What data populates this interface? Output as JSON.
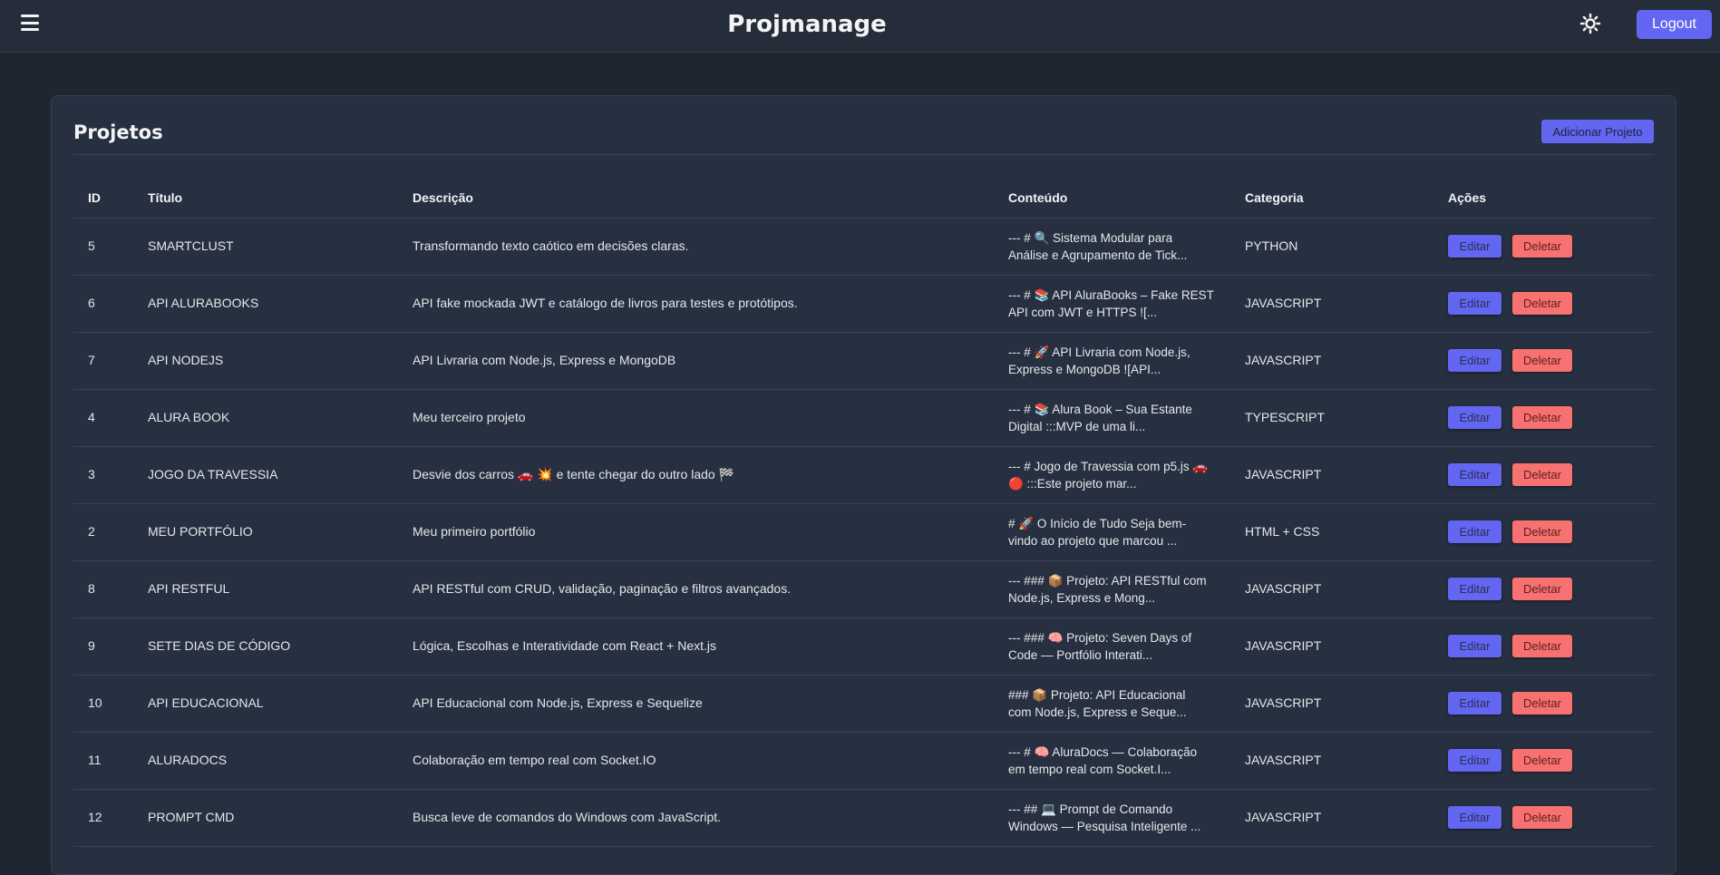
{
  "header": {
    "title": "Projmanage",
    "logout_label": "Logout",
    "menu_icon": "hamburger-menu-icon",
    "theme_icon": "sun-icon"
  },
  "card": {
    "title": "Projetos",
    "add_label": "Adicionar Projeto"
  },
  "table": {
    "columns": [
      "ID",
      "Título",
      "Descrição",
      "Conteúdo",
      "Categoria",
      "Ações"
    ],
    "edit_label": "Editar",
    "delete_label": "Deletar",
    "rows": [
      {
        "id": "5",
        "title": "SMARTCLUST",
        "description": "Transformando texto caótico em decisões claras.",
        "content_1": "--- # 🔍 Sistema Modular para",
        "content_2": "Análise e Agrupamento de Tick...",
        "category": "PYTHON"
      },
      {
        "id": "6",
        "title": "API ALURABOOKS",
        "description": "API fake mockada JWT e catálogo de livros para testes e protótipos.",
        "content_1": "--- # 📚 API AluraBooks – Fake REST",
        "content_2": "API com JWT e HTTPS ![...",
        "category": "JAVASCRIPT"
      },
      {
        "id": "7",
        "title": "API NODEJS",
        "description": "API Livraria com Node.js, Express e MongoDB",
        "content_1": "--- # 🚀 API Livraria com Node.js,",
        "content_2": "Express e MongoDB ![API...",
        "category": "JAVASCRIPT"
      },
      {
        "id": "4",
        "title": "ALURA BOOK",
        "description": "Meu terceiro projeto",
        "content_1": "--- # 📚 Alura Book – Sua Estante",
        "content_2": "Digital :::MVP de uma li...",
        "category": "TYPESCRIPT"
      },
      {
        "id": "3",
        "title": "JOGO DA TRAVESSIA",
        "description": "Desvie dos carros 🚗 💥 e tente chegar do outro lado 🏁",
        "content_1": "--- # Jogo de Travessia com p5.js 🚗",
        "content_2": "🔴 :::Este projeto mar...",
        "category": "JAVASCRIPT"
      },
      {
        "id": "2",
        "title": "MEU PORTFÓLIO",
        "description": "Meu primeiro portfólio",
        "content_1": "# 🚀 O Início de Tudo Seja bem-",
        "content_2": "vindo ao projeto que marcou ...",
        "category": "HTML + CSS"
      },
      {
        "id": "8",
        "title": "API RESTFUL",
        "description": "API RESTful com CRUD, validação, paginação e filtros avançados.",
        "content_1": "--- ### 📦 Projeto: API RESTful com",
        "content_2": "Node.js, Express e Mong...",
        "category": "JAVASCRIPT"
      },
      {
        "id": "9",
        "title": "SETE DIAS DE CÓDIGO",
        "description": "Lógica, Escolhas e Interatividade com React + Next.js",
        "content_1": "--- ### 🧠 Projeto: Seven Days of",
        "content_2": "Code — Portfólio Interati...",
        "category": "JAVASCRIPT"
      },
      {
        "id": "10",
        "title": "API EDUCACIONAL",
        "description": "API Educacional com Node.js, Express e Sequelize",
        "content_1": "### 📦 Projeto: API Educacional",
        "content_2": "com Node.js, Express e Seque...",
        "category": "JAVASCRIPT"
      },
      {
        "id": "11",
        "title": "ALURADOCS",
        "description": "Colaboração em tempo real com Socket.IO",
        "content_1": "--- # 🧠 AluraDocs — Colaboração",
        "content_2": "em tempo real com Socket.I...",
        "category": "JAVASCRIPT"
      },
      {
        "id": "12",
        "title": "PROMPT CMD",
        "description": "Busca leve de comandos do Windows com JavaScript.",
        "content_1": "--- ## 💻 Prompt de Comando",
        "content_2": "Windows — Pesquisa Inteligente ...",
        "category": "JAVASCRIPT"
      }
    ]
  }
}
